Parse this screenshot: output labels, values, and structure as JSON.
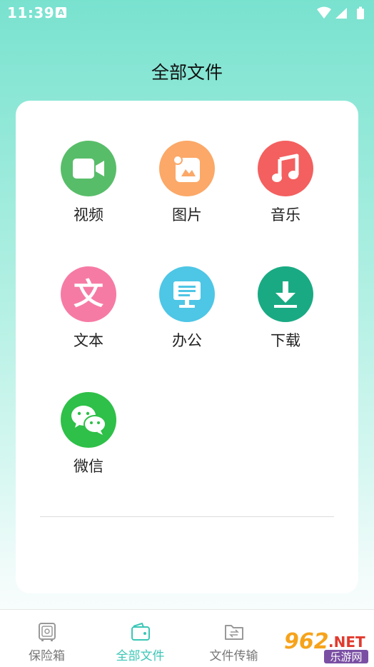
{
  "status_bar": {
    "time": "11:39",
    "badge": "A"
  },
  "page": {
    "title": "全部文件"
  },
  "categories": [
    {
      "label": "视频",
      "icon": "video-camera-icon",
      "color": "#58bd69"
    },
    {
      "label": "图片",
      "icon": "photo-icon",
      "color": "#fba868"
    },
    {
      "label": "音乐",
      "icon": "music-note-icon",
      "color": "#f3605f"
    },
    {
      "label": "文本",
      "icon": "text-document-icon",
      "color": "#f67ba4"
    },
    {
      "label": "办公",
      "icon": "monitor-icon",
      "color": "#4ec6e6"
    },
    {
      "label": "下载",
      "icon": "download-icon",
      "color": "#19aa83"
    },
    {
      "label": "微信",
      "icon": "wechat-icon",
      "color": "#2ec048"
    }
  ],
  "text_glyph": "文",
  "bottom_nav": {
    "items": [
      {
        "label": "保险箱",
        "icon": "safe-icon",
        "active": false
      },
      {
        "label": "全部文件",
        "icon": "wallet-folder-icon",
        "active": true
      },
      {
        "label": "文件传输",
        "icon": "folder-transfer-icon",
        "active": false
      }
    ],
    "accent_color": "#3bc6b6"
  },
  "watermark": {
    "number": "962",
    "domain": ".NET",
    "text": "乐游网"
  }
}
